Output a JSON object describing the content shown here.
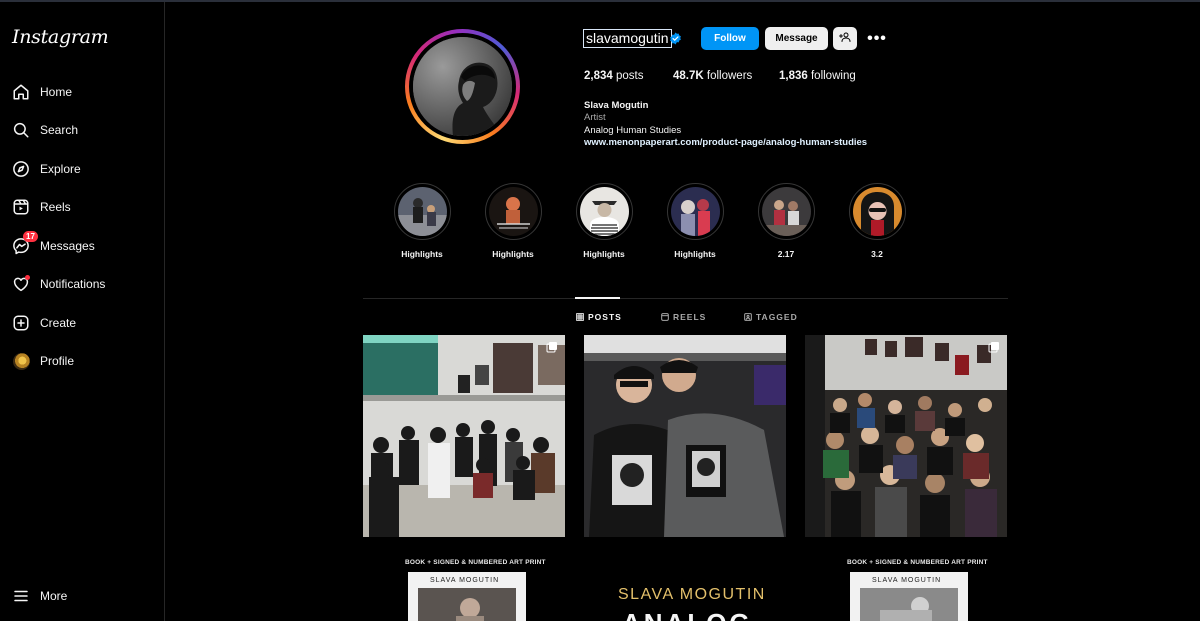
{
  "app": {
    "logo": "Instagram"
  },
  "sidebar": {
    "items": [
      {
        "label": "Home",
        "icon": "home-icon"
      },
      {
        "label": "Search",
        "icon": "search-icon"
      },
      {
        "label": "Explore",
        "icon": "compass-icon"
      },
      {
        "label": "Reels",
        "icon": "reels-icon"
      },
      {
        "label": "Messages",
        "icon": "messenger-icon",
        "badge": "17"
      },
      {
        "label": "Notifications",
        "icon": "heart-icon"
      },
      {
        "label": "Create",
        "icon": "plus-square-icon"
      },
      {
        "label": "Profile",
        "icon": "avatar"
      }
    ],
    "more": "More"
  },
  "profile": {
    "username": "slavamogutin",
    "verified": true,
    "follow_label": "Follow",
    "message_label": "Message",
    "more_label": "•••",
    "stats": {
      "posts_value": "2,834",
      "posts_label": "posts",
      "followers_value": "48.7K",
      "followers_label": "followers",
      "following_value": "1,836",
      "following_label": "following"
    },
    "bio": {
      "name": "Slava Mogutin",
      "category": "Artist",
      "line": "Analog Human Studies",
      "link": "www.menonpaperart.com/product-page/analog-human-studies"
    }
  },
  "highlights": [
    {
      "label": "Highlights"
    },
    {
      "label": "Highlights"
    },
    {
      "label": "Highlights"
    },
    {
      "label": "Highlights"
    },
    {
      "label": "2.17"
    },
    {
      "label": "3.2"
    }
  ],
  "tabs": [
    {
      "label": "POSTS",
      "active": true,
      "icon": "grid-icon"
    },
    {
      "label": "REELS",
      "active": false,
      "icon": "reels-icon"
    },
    {
      "label": "TAGGED",
      "active": false,
      "icon": "tagged-icon"
    }
  ],
  "posts_row2": {
    "left_caption": "BOOK + SIGNED & NUMBERED ART PRINT",
    "left_title": "SLAVA MOGUTIN",
    "center_title": "SLAVA MOGUTIN",
    "center_sub": "ANALOG",
    "right_caption": "BOOK + SIGNED & NUMBERED ART PRINT"
  },
  "colors": {
    "accent": "#0095f6",
    "badge": "#ff3040",
    "background": "#000000"
  }
}
